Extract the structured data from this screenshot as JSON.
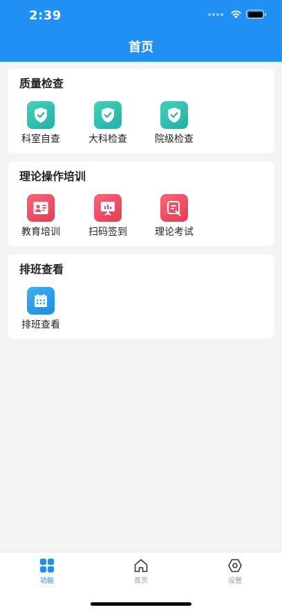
{
  "status_bar": {
    "time": "2:39"
  },
  "header": {
    "title": "首页"
  },
  "sections": [
    {
      "title": "质量检查",
      "items": [
        {
          "label": "科室自查",
          "icon": "shield-check-icon",
          "color": "#2ec0ad"
        },
        {
          "label": "大科检查",
          "icon": "shield-check-icon",
          "color": "#2ec0ad"
        },
        {
          "label": "院级检查",
          "icon": "shield-check-icon",
          "color": "#2ec0ad"
        }
      ]
    },
    {
      "title": "理论操作培训",
      "items": [
        {
          "label": "教育培训",
          "icon": "id-card-icon",
          "color": "#ef4c62"
        },
        {
          "label": "扫码签到",
          "icon": "presentation-board-icon",
          "color": "#ef4c62"
        },
        {
          "label": "理论考试",
          "icon": "exam-edit-icon",
          "color": "#ef4c62"
        }
      ]
    },
    {
      "title": "排班查看",
      "items": [
        {
          "label": "排班查看",
          "icon": "calendar-icon",
          "color": "#2a9ff0"
        }
      ]
    }
  ],
  "tabbar": {
    "tabs": [
      {
        "label": "功能",
        "icon": "grid-icon",
        "active": true
      },
      {
        "label": "首页",
        "icon": "home-icon",
        "active": false
      },
      {
        "label": "设置",
        "icon": "hexagon-settings-icon",
        "active": false
      }
    ]
  },
  "colors": {
    "primary": "#2090f5",
    "background": "#f4f4f4"
  }
}
